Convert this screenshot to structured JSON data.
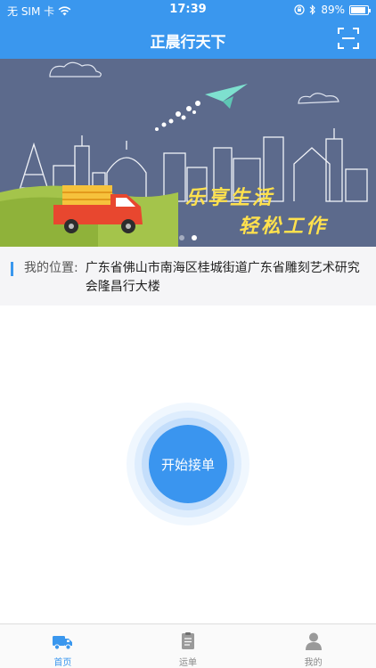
{
  "status_bar": {
    "carrier": "无 SIM 卡",
    "time": "17:39",
    "battery": "89%",
    "battery_level": 0.89
  },
  "header": {
    "title": "正晨行天下",
    "scan_icon": "scan-icon"
  },
  "banner": {
    "slogan_line1": "乐享生活",
    "slogan_line2": "轻松工作",
    "page_count": 2,
    "active_page": 2
  },
  "location": {
    "label": "我的位置:",
    "value": "广东省佛山市南海区桂城街道广东省雕刻艺术研究会隆昌行大楼"
  },
  "start": {
    "label": "开始接单"
  },
  "tabbar": {
    "items": [
      {
        "label": "首页",
        "icon": "truck-icon",
        "active": true
      },
      {
        "label": "运单",
        "icon": "clipboard-icon",
        "active": false
      },
      {
        "label": "我的",
        "icon": "user-icon",
        "active": false
      }
    ]
  },
  "colors": {
    "primary": "#3a97ee",
    "banner_bg": "#5c6a8c",
    "slogan": "#ffe14d"
  }
}
